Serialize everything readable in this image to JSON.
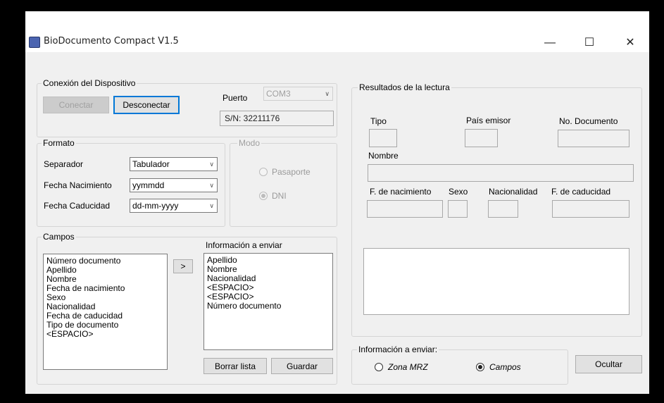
{
  "app": {
    "title": "BioDocumento Compact V1.5"
  },
  "window_controls": {
    "minimize": "—",
    "maximize": "☐",
    "close": "✕"
  },
  "conexion": {
    "label": "Conexión del Dispositivo",
    "connect_label": "Conectar",
    "disconnect_label": "Desconectar",
    "port_label": "Puerto",
    "port_value": "COM3",
    "serial": "S/N: 32211176"
  },
  "formato": {
    "label": "Formato",
    "separador_label": "Separador",
    "separador_value": "Tabulador",
    "fecha_nac_label": "Fecha Nacimiento",
    "fecha_nac_value": "yymmdd",
    "fecha_cad_label": "Fecha Caducidad",
    "fecha_cad_value": "dd-mm-yyyy"
  },
  "modo": {
    "label": "Modo",
    "pasaporte": "Pasaporte",
    "dni": "DNI",
    "selected": "DNI"
  },
  "campos": {
    "label": "Campos",
    "items": [
      "Número documento",
      "Apellido",
      "Nombre",
      "Fecha de nacimiento",
      "Sexo",
      "Nacionalidad",
      "Fecha de caducidad",
      "Tipo de documento",
      "<ESPACIO>"
    ],
    "move_label": ">",
    "info_label": "Información a enviar",
    "info_items": [
      "Apellido",
      "Nombre",
      "Nacionalidad",
      "<ESPACIO>",
      "<ESPACIO>",
      "Número documento"
    ],
    "clear_label": "Borrar lista",
    "save_label": "Guardar"
  },
  "resultados": {
    "label": "Resultados de la lectura",
    "tipo": "Tipo",
    "pais": "País emisor",
    "no_doc": "No. Documento",
    "nombre": "Nombre",
    "f_nac": "F. de nacimiento",
    "sexo": "Sexo",
    "nacionalidad": "Nacionalidad",
    "f_cad": "F. de caducidad"
  },
  "envio": {
    "label": "Información a enviar:",
    "zona_mrz": "Zona MRZ",
    "campos": "Campos",
    "selected": "Campos",
    "hide_label": "Ocultar"
  },
  "colors": {
    "accent": "#0078d7",
    "window_bg": "#f0f0f0"
  },
  "icons": {
    "app": "app-icon"
  }
}
